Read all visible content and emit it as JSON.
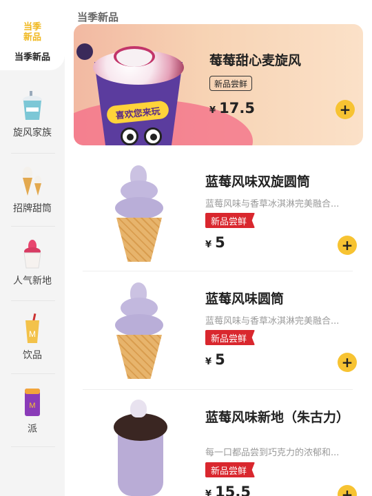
{
  "sidebar": {
    "items": [
      {
        "label": "当季新品",
        "icon": "new-products-icon",
        "active": true
      },
      {
        "label": "旋风家族",
        "icon": "mcflurry-icon",
        "active": false
      },
      {
        "label": "招牌甜筒",
        "icon": "cone-icon",
        "active": false
      },
      {
        "label": "人气新地",
        "icon": "sundae-icon",
        "active": false
      },
      {
        "label": "饮品",
        "icon": "drink-icon",
        "active": false
      },
      {
        "label": "派",
        "icon": "pie-icon",
        "active": false
      }
    ],
    "active_logo_text": "当季\n新品"
  },
  "main": {
    "section_title": "当季新品",
    "hero": {
      "name": "莓莓甜心麦旋风",
      "tag": "新品尝鲜",
      "currency": "¥",
      "price": "17.5",
      "sticker": "喜欢您来玩"
    },
    "products": [
      {
        "name": "蓝莓风味双旋圆筒",
        "desc": "蓝莓风味与香草冰淇淋完美融合...",
        "badge": "新品尝鲜",
        "currency": "¥",
        "price": "5"
      },
      {
        "name": "蓝莓风味圆筒",
        "desc": "蓝莓风味与香草冰淇淋完美融合...",
        "badge": "新品尝鲜",
        "currency": "¥",
        "price": "5"
      },
      {
        "name": "蓝莓风味新地（朱古力）",
        "desc": "每一口都品尝到巧克力的浓郁和...",
        "badge": "新品尝鲜",
        "currency": "¥",
        "price": "15.5"
      }
    ],
    "add_symbol": "+"
  },
  "colors": {
    "accent_yellow": "#f7c332",
    "badge_red": "#d9272e",
    "hero_bg": "#f7d3b4"
  }
}
